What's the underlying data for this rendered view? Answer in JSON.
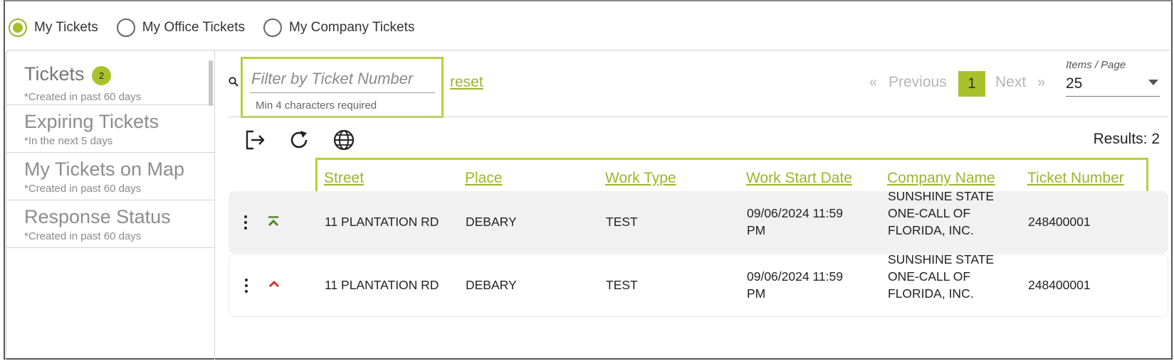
{
  "view_filters": [
    {
      "label": "My Tickets",
      "selected": true
    },
    {
      "label": "My Office Tickets",
      "selected": false
    },
    {
      "label": "My Company Tickets",
      "selected": false
    }
  ],
  "sidebar": {
    "items": [
      {
        "title": "Tickets",
        "badge": "2",
        "sub": "*Created in past 60 days"
      },
      {
        "title": "Expiring Tickets",
        "sub": "*In the next 5 days"
      },
      {
        "title": "My Tickets on Map",
        "sub": "*Created in past 60 days"
      },
      {
        "title": "Response Status",
        "sub": "*Created in past 60 days"
      }
    ]
  },
  "filter": {
    "placeholder": "Filter by Ticket Number",
    "value": "",
    "hint": "Min 4 characters required",
    "reset_label": "reset"
  },
  "pagination": {
    "prev_arrow": "«",
    "prev_label": "Previous",
    "current_page": "1",
    "next_label": "Next",
    "next_arrow": "»",
    "items_per_page_label": "Items / Page",
    "items_per_page_value": "25"
  },
  "toolbar": {
    "icons": [
      "export-icon",
      "refresh-icon",
      "globe-icon"
    ],
    "results_text": "Results: 2"
  },
  "table": {
    "columns": [
      "Street",
      "Place",
      "Work Type",
      "Work Start Date",
      "Company Name",
      "Ticket Number"
    ],
    "rows": [
      {
        "priority": "double-chevron-up-icon",
        "priority_color": "#4a8a1e",
        "street": "11 PLANTATION RD",
        "place": "DEBARY",
        "work_type": "TEST",
        "work_start_date_line1": "09/06/2024 11:59",
        "work_start_date_line2": "PM",
        "company_line1": "SUNSHINE STATE",
        "company_line2": "ONE-CALL OF",
        "company_line3": "FLORIDA, INC.",
        "ticket_number": "248400001"
      },
      {
        "priority": "chevron-up-icon",
        "priority_color": "#d0352a",
        "street": "11 PLANTATION RD",
        "place": "DEBARY",
        "work_type": "TEST",
        "work_start_date_line1": "09/06/2024 11:59",
        "work_start_date_line2": "PM",
        "company_line1": "SUNSHINE STATE",
        "company_line2": "ONE-CALL OF",
        "company_line3": "FLORIDA, INC.",
        "ticket_number": "248400001"
      }
    ]
  },
  "colors": {
    "accent": "#a9c22a",
    "highlight_border": "#b8cf3a"
  }
}
